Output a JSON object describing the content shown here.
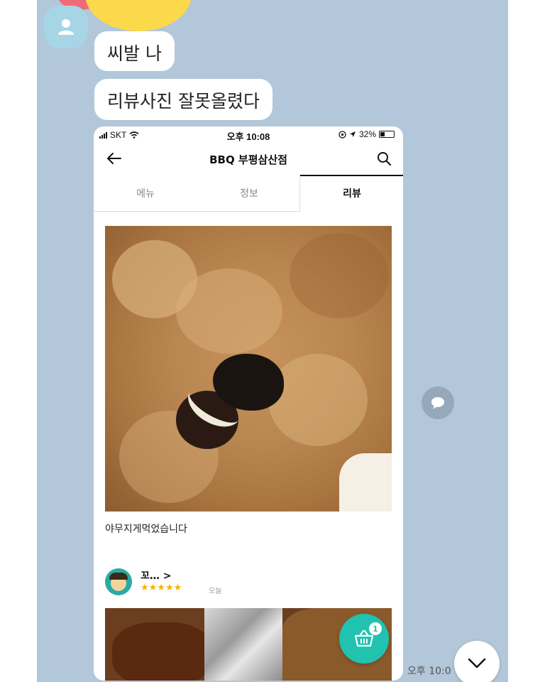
{
  "chat": {
    "messages": [
      {
        "text": "씨발 나"
      },
      {
        "text": "리뷰사진 잘못올렸다"
      }
    ],
    "timestamp": "오후 10:0",
    "icons": {
      "avatar": "person-icon",
      "message_action": "speech-bubble-icon",
      "scroll_down": "chevron-down-icon"
    }
  },
  "screenshot": {
    "status_bar": {
      "carrier": "SKT",
      "time": "오후 10:08",
      "battery": "32%"
    },
    "header": {
      "title": "BBQ 부평삼산점",
      "icons": {
        "back": "arrow-left-icon",
        "search": "search-icon"
      }
    },
    "tabs": [
      {
        "label": "메뉴"
      },
      {
        "label": "정보"
      },
      {
        "label": "리뷰",
        "active": true
      }
    ],
    "review": {
      "text": "야무지게먹었습니다"
    },
    "next_review": {
      "name": "꼬… >",
      "stars": "★★★★★",
      "rating": 5,
      "date": "오늘"
    },
    "cart": {
      "badge": "1",
      "icon": "basket-icon"
    }
  },
  "colors": {
    "chat_background": "#b2c7d9",
    "accent_teal": "#21c2b0",
    "star": "#f5b301"
  }
}
